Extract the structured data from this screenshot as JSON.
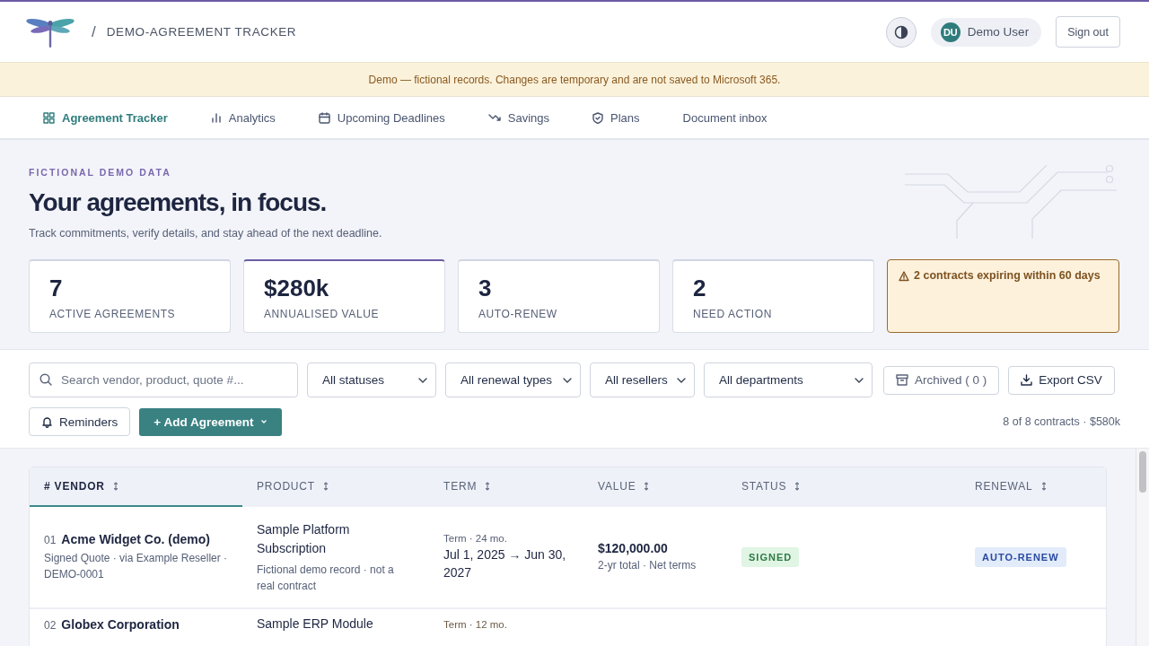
{
  "header": {
    "separator": "/",
    "title": "DEMO-AGREEMENT TRACKER",
    "user": {
      "initials": "DU",
      "name": "Demo User"
    },
    "sign_out": "Sign out"
  },
  "banner": "Demo — fictional records. Changes are temporary and are not saved to Microsoft 365.",
  "nav": [
    {
      "label": "Agreement Tracker",
      "selected": true
    },
    {
      "label": "Analytics",
      "selected": false
    },
    {
      "label": "Upcoming Deadlines",
      "selected": false
    },
    {
      "label": "Savings",
      "selected": false
    },
    {
      "label": "Plans",
      "selected": false
    },
    {
      "label": "Document inbox",
      "selected": false
    }
  ],
  "hero": {
    "eyebrow": "FICTIONAL DEMO DATA",
    "title": "Your agreements, in focus.",
    "subtitle": "Track commitments, verify details, and stay ahead of the next deadline."
  },
  "stats": [
    {
      "value": "7",
      "label": "ACTIVE AGREEMENTS",
      "selected": false
    },
    {
      "value": "$280k",
      "label": "ANNUALISED VALUE",
      "selected": true
    },
    {
      "value": "3",
      "label": "AUTO-RENEW",
      "selected": false
    },
    {
      "value": "2",
      "label": "NEED ACTION",
      "selected": false
    }
  ],
  "alert": {
    "text": "2 contracts expiring within 60 days"
  },
  "filters": {
    "search_placeholder": "Search vendor, product, quote #...",
    "selects": [
      "All statuses",
      "All renewal types",
      "All resellers",
      "All departments"
    ],
    "archived": "Archived ( 0 )",
    "export": "Export CSV",
    "reminders": "Reminders",
    "add": "+ Add Agreement",
    "summary": "8 of 8 contracts · $580k"
  },
  "table": {
    "columns": [
      {
        "label": "# VENDOR",
        "selected": true
      },
      {
        "label": "PRODUCT",
        "selected": false
      },
      {
        "label": "TERM",
        "selected": false
      },
      {
        "label": "VALUE",
        "selected": false
      },
      {
        "label": "STATUS",
        "selected": false
      },
      {
        "label": "RENEWAL",
        "selected": false
      }
    ],
    "rows": [
      {
        "number": "01",
        "vendor": "Acme Widget Co. (demo)",
        "vendor_meta": "Signed Quote · via Example Reseller · DEMO-0001",
        "product": "Sample Platform Subscription",
        "product_note": "Fictional demo record · not a real contract",
        "term_label": "Term · 24 mo.",
        "term_dates": "Jul 1, 2025 → Jun 30, 2027",
        "expiring": false,
        "value": "$120,000.00",
        "value_note": "2-yr total · Net terms",
        "status": {
          "text": "SIGNED",
          "kind": "signed"
        },
        "renewal": {
          "text": "AUTO-RENEW",
          "kind": "auto"
        }
      },
      {
        "number": "02",
        "vendor": "Globex Corporation",
        "product": "Sample ERP Module",
        "term_label": "Term · 12 mo.",
        "expiring": true
      }
    ]
  }
}
